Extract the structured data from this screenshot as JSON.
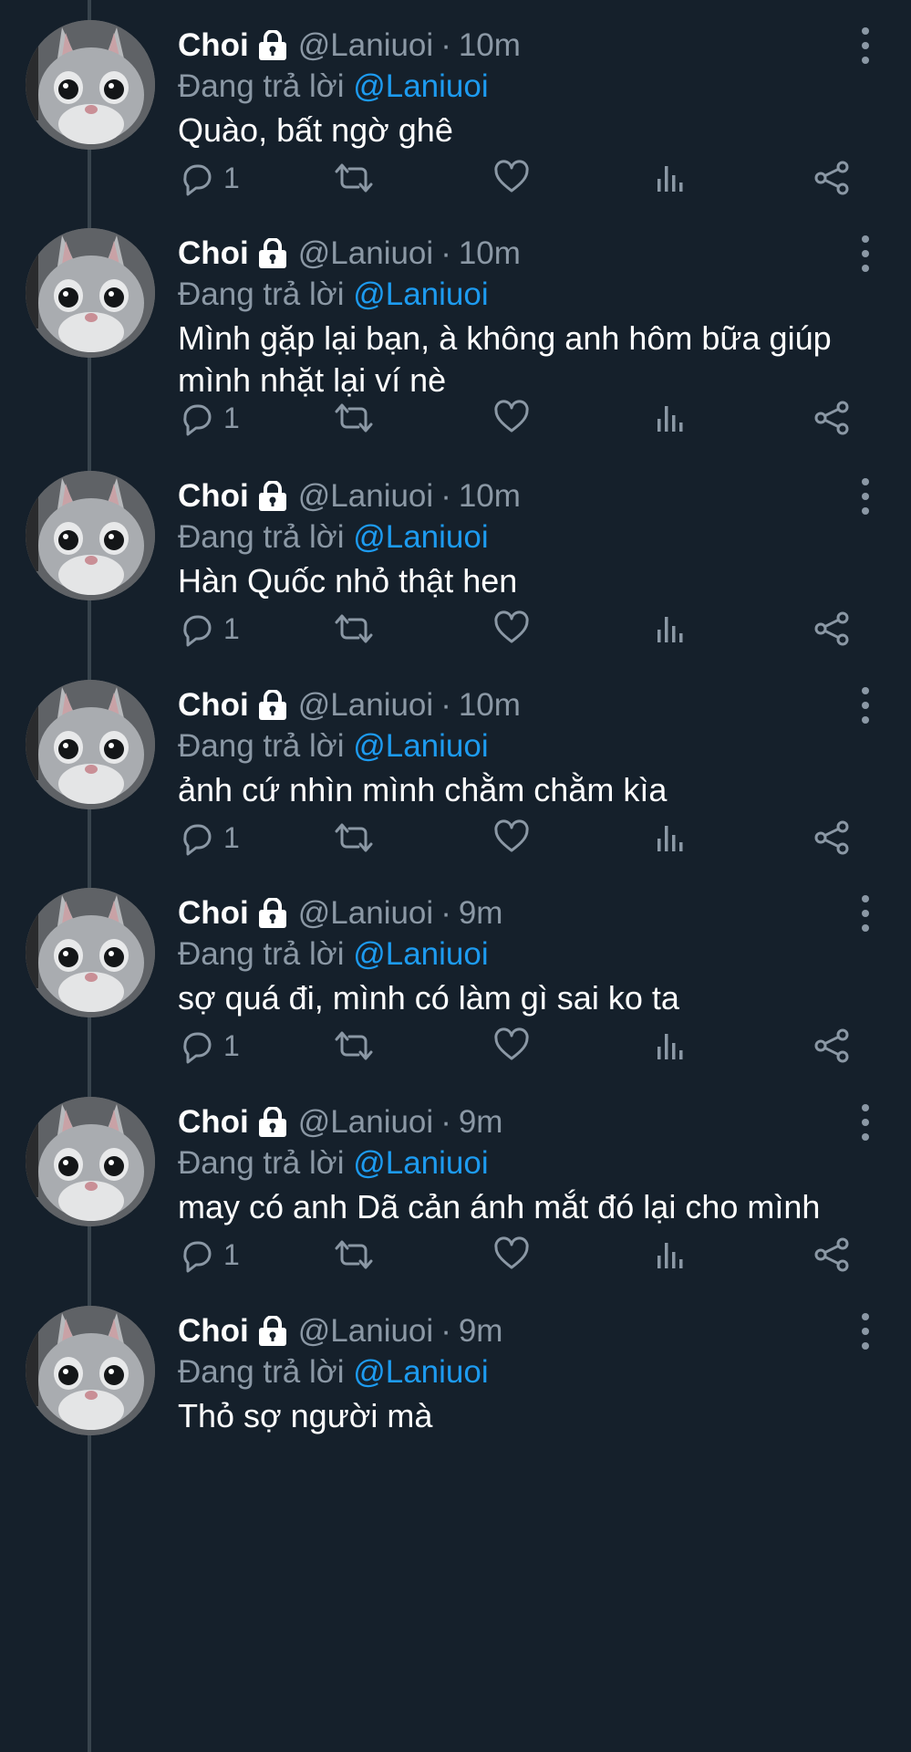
{
  "colors": {
    "background": "#15202b",
    "secondary_text": "#8b98a5",
    "mention": "#1d9bf0",
    "thread_line": "#38444d"
  },
  "icons": {
    "lock": "lock-icon",
    "more": "more-vertical-icon",
    "reply": "reply-icon",
    "retweet": "retweet-icon",
    "like": "heart-icon",
    "analytics": "analytics-icon",
    "share": "share-icon"
  },
  "tweets": [
    {
      "name": "Choi",
      "handle": "@Laniuoi",
      "separator": "·",
      "time": "10m",
      "reply_prefix": "Đang trả lời",
      "reply_mention": "@Laniuoi",
      "text": "Quào, bất ngờ ghê",
      "reply_count": "1"
    },
    {
      "name": "Choi",
      "handle": "@Laniuoi",
      "separator": "·",
      "time": "10m",
      "reply_prefix": "Đang trả lời",
      "reply_mention": "@Laniuoi",
      "text": "Mình gặp lại bạn, à không anh hôm bữa giúp mình nhặt lại ví nè",
      "reply_count": "1"
    },
    {
      "name": "Choi",
      "handle": "@Laniuoi",
      "separator": "·",
      "time": "10m",
      "reply_prefix": "Đang trả lời",
      "reply_mention": "@Laniuoi",
      "text": "Hàn Quốc nhỏ thật hen",
      "reply_count": "1"
    },
    {
      "name": "Choi",
      "handle": "@Laniuoi",
      "separator": "·",
      "time": "10m",
      "reply_prefix": "Đang trả lời",
      "reply_mention": "@Laniuoi",
      "text": "ảnh cứ nhìn mình chằm chằm kìa",
      "reply_count": "1"
    },
    {
      "name": "Choi",
      "handle": "@Laniuoi",
      "separator": "·",
      "time": "9m",
      "reply_prefix": "Đang trả lời",
      "reply_mention": "@Laniuoi",
      "text": "sợ quá đi, mình có làm gì sai ko ta",
      "reply_count": "1"
    },
    {
      "name": "Choi",
      "handle": "@Laniuoi",
      "separator": "·",
      "time": "9m",
      "reply_prefix": "Đang trả lời",
      "reply_mention": "@Laniuoi",
      "text": "may có anh Dã cản ánh mắt đó lại cho mình",
      "reply_count": "1"
    },
    {
      "name": "Choi",
      "handle": "@Laniuoi",
      "separator": "·",
      "time": "9m",
      "reply_prefix": "Đang trả lời",
      "reply_mention": "@Laniuoi",
      "text": "Thỏ sợ người mà",
      "reply_count": ""
    }
  ]
}
